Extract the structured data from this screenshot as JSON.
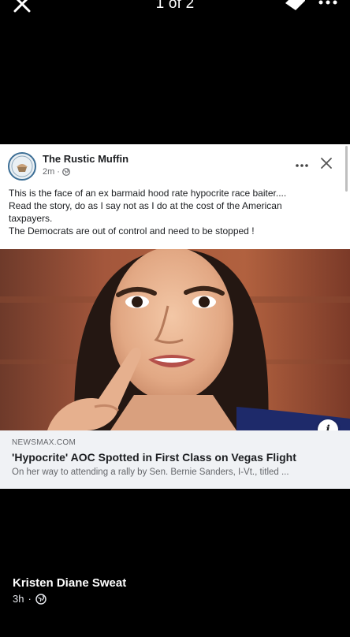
{
  "viewer": {
    "pager": "1 of 2"
  },
  "post": {
    "page_name": "The Rustic Muffin",
    "time": "2m",
    "separator": "·",
    "text_lines": [
      "This is the face of an ex barmaid hood rate hypocrite race baiter....",
      "Read the story, do as I say not as I do at the cost of the American",
      "taxpayers.",
      "The Democrats are out of control and need to be stopped !"
    ],
    "link": {
      "domain": "NEWSMAX.COM",
      "title": "'Hypocrite' AOC Spotted in First Class on Vegas Flight",
      "description": "On her way to attending a rally by Sen. Bernie Sanders, I-Vt., titled ..."
    }
  },
  "attribution": {
    "author": "Kristen Diane Sweat",
    "time": "3h",
    "separator": "·"
  },
  "colors": {
    "background": "#000000",
    "card": "#ffffff",
    "link_bg": "#f0f2f5",
    "text_primary": "#1c1e21",
    "text_secondary": "#65676b"
  },
  "icons": {
    "close": "close-icon",
    "tag": "tag-icon",
    "more": "more-icon",
    "globe": "globe-icon",
    "info": "info-icon"
  }
}
